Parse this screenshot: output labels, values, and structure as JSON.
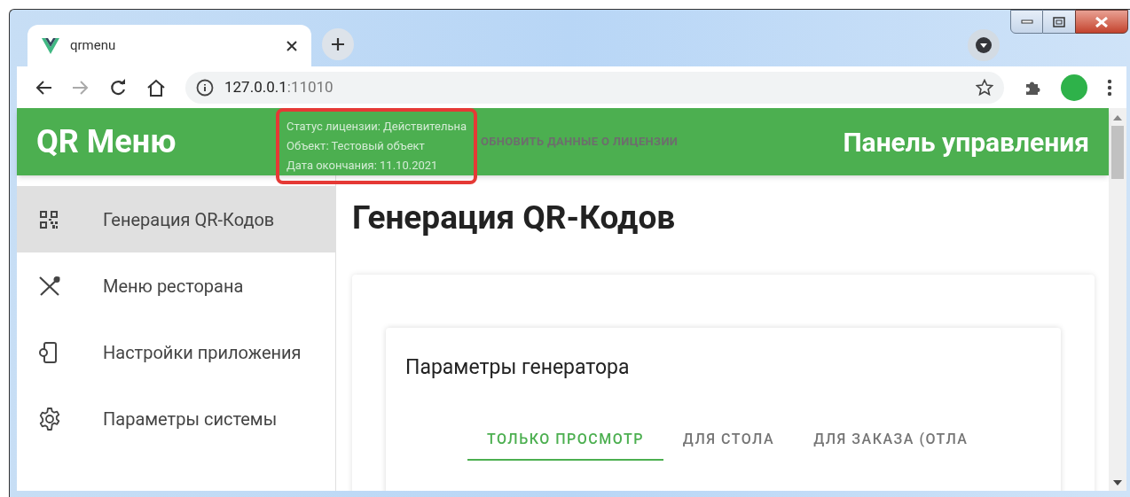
{
  "browser": {
    "tab_title": "qrmenu",
    "url_host": "127.0.0.1",
    "url_port": ":11010"
  },
  "header": {
    "logo": "QR Меню",
    "license": [
      "Статус лицензии: Действительна",
      "Объект: Тестовый объект",
      "Дата окончания: 11.10.2021"
    ],
    "refresh_button": "ОБНОВИТЬ ДАННЫЕ О ЛИЦЕНЗИИ",
    "panel_title": "Панель управления"
  },
  "sidebar": {
    "items": [
      {
        "kind": "qr",
        "label": "Генерация QR-Кодов",
        "selected": true
      },
      {
        "kind": "cutlery",
        "label": "Меню ресторана",
        "selected": false
      },
      {
        "kind": "device",
        "label": "Настройки приложения",
        "selected": false
      },
      {
        "kind": "gear",
        "label": "Параметры системы",
        "selected": false
      }
    ]
  },
  "page": {
    "title": "Генерация QR-Кодов",
    "card_title": "Параметры генератора",
    "tabs": [
      {
        "label": "ТОЛЬКО ПРОСМОТР",
        "selected": true
      },
      {
        "label": "ДЛЯ СТОЛА",
        "selected": false
      },
      {
        "label": "ДЛЯ ЗАКАЗА (ОТЛА",
        "selected": false
      }
    ]
  }
}
